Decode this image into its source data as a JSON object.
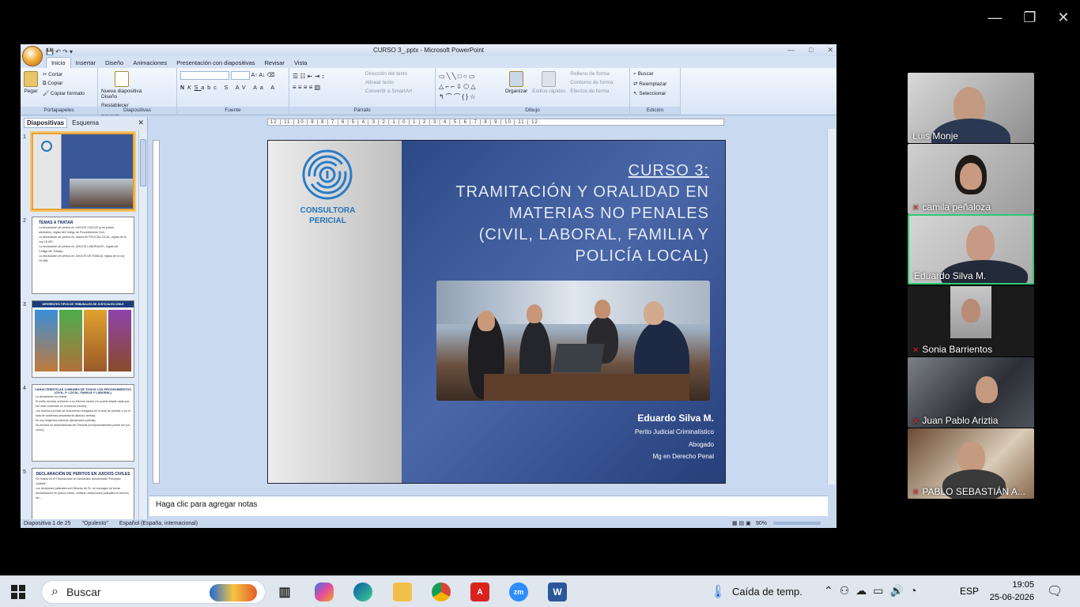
{
  "zoom_window": {
    "minimize": "—",
    "restore": "❐",
    "close": "✕"
  },
  "ppt": {
    "title": "CURSO 3_.pptx - Microsoft PowerPoint",
    "win_min": "—",
    "win_max": "□",
    "win_close": "✕",
    "tabs": [
      "Inicio",
      "Insertar",
      "Diseño",
      "Animaciones",
      "Presentación con diapositivas",
      "Revisar",
      "Vista"
    ],
    "ribbon": {
      "clipboard": {
        "paste": "Pegar",
        "cut": "Cortar",
        "copy": "Copiar",
        "format_painter": "Copiar formato",
        "label": "Portapapeles"
      },
      "slides": {
        "new_slide": "Nueva diapositiva",
        "layout": "Diseño",
        "reset": "Restablecer",
        "delete": "Eliminar",
        "label": "Diapositivas"
      },
      "font": {
        "label": "Fuente"
      },
      "paragraph": {
        "text_direction": "Dirección del texto",
        "align_text": "Alinear texto",
        "smartart": "Convertir a SmartArt",
        "label": "Párrafo"
      },
      "drawing": {
        "arrange": "Organizar",
        "quick_styles": "Estilos rápidos",
        "fill": "Relleno de forma",
        "outline": "Contorno de forma",
        "effects": "Efectos de forma",
        "label": "Dibujo"
      },
      "editing": {
        "find": "Buscar",
        "replace": "Reemplazar",
        "select": "Seleccionar",
        "label": "Edición"
      }
    },
    "left_pane": {
      "tab_slides": "Diapositivas",
      "tab_outline": "Esquema",
      "close": "✕"
    },
    "thumbnails": [
      {
        "num": "1"
      },
      {
        "num": "2",
        "title": "TEMAS A TRATAR",
        "lines": [
          "La declaración de peritos en JUICIOS CIVILES (y en juicios arbitrales), reglas del Código de Procedimiento Civil;",
          "La declaración de peritos en Juicios de POLICÍA LOCAL, reglas de la Ley 18.287;",
          "La declaración de peritos en JUICIOS LABORALES, reglas del Código del Trabajo;",
          "La declaración de peritos en JUICIOS DE FAMILIA, reglas de la Ley 19.968;"
        ]
      },
      {
        "num": "3",
        "title": "DIFERENTES TIPOS DE TRIBUNALES DE JUSTICIA EN CHILE"
      },
      {
        "num": "4",
        "title": "CARACTERÍSTICAS COMUNES DE TODOS LOS PROCEDIMIENTOS (CIVIL, P. LOCAL, FAMILIA Y LABORAL)",
        "lines": [
          "La declaración es verbal;",
          "El perito declara conforme a su informe escrito (no puede añadir nada que NO esté contenido en el informe escrito);",
          "Los hechos a probar se encuentran recogidos en el auto de prueba; o en el acta de audiencia preparatoria (laboral, familia);",
          "Es una diligencia solemne (declaración judicial);",
          "Se declara en dependencias del Tribunal (excepcionalmente puede ser por zoom);"
        ]
      },
      {
        "num": "5",
        "title": "DECLARACIÓN DE PERITOS EN JUICIOS CIVILES",
        "lines": [
          "Se realiza en el Tribunal ante un funcionario denominado \"Receptor Judicial\";",
          "Los receptores judiciales son Ministro de Fe, se encargan de tomar declaraciones en juicios civiles, notificar resoluciones judiciales en terreno, etc.;"
        ]
      }
    ],
    "ruler_h": "·12·|·11·|·10·|·9·|·8·|·7·|·6·|·5·|·4·|·3·|·2·|·1·|·0·|·1·|·2·|·3·|·4·|·5·|·6·|·7·|·8·|·9·|·10·|·11·|·12·",
    "slide": {
      "logo_text_1": "CONSULTORA",
      "logo_text_2": "PERICIAL",
      "title_lines": [
        "CURSO 3:",
        "TRAMITACIÓN Y ORALIDAD EN",
        "MATERIAS NO PENALES",
        "(CIVIL, LABORAL, FAMILIA Y",
        "POLICÍA LOCAL)"
      ],
      "author_name": "Eduardo Silva M.",
      "author_lines": [
        "Perito Judicial Criminalístico",
        "Abogado",
        "Mg en Derecho Penal"
      ]
    },
    "notes_placeholder": "Haga clic para agregar notas",
    "status": {
      "slide": "Diapositiva 1 de 25",
      "theme": "\"Opulento\"",
      "lang": "Español (España, internacional)",
      "zoom": "90%"
    }
  },
  "participants": [
    {
      "name": "Luis Monje",
      "muted": false
    },
    {
      "name": "camila peñaloza",
      "muted": true
    },
    {
      "name": "Eduardo Silva M.",
      "muted": false
    },
    {
      "name": "Sonia Barrientos",
      "muted": true
    },
    {
      "name": "Juan Pablo Ariztia",
      "muted": true
    },
    {
      "name": "PABLO SEBASTIÁN A...",
      "muted": true
    }
  ],
  "taskbar": {
    "search": "Buscar",
    "weather": "Caída de temp.",
    "lang": "ESP",
    "time": "19:05",
    "date": "25-06-2026"
  }
}
